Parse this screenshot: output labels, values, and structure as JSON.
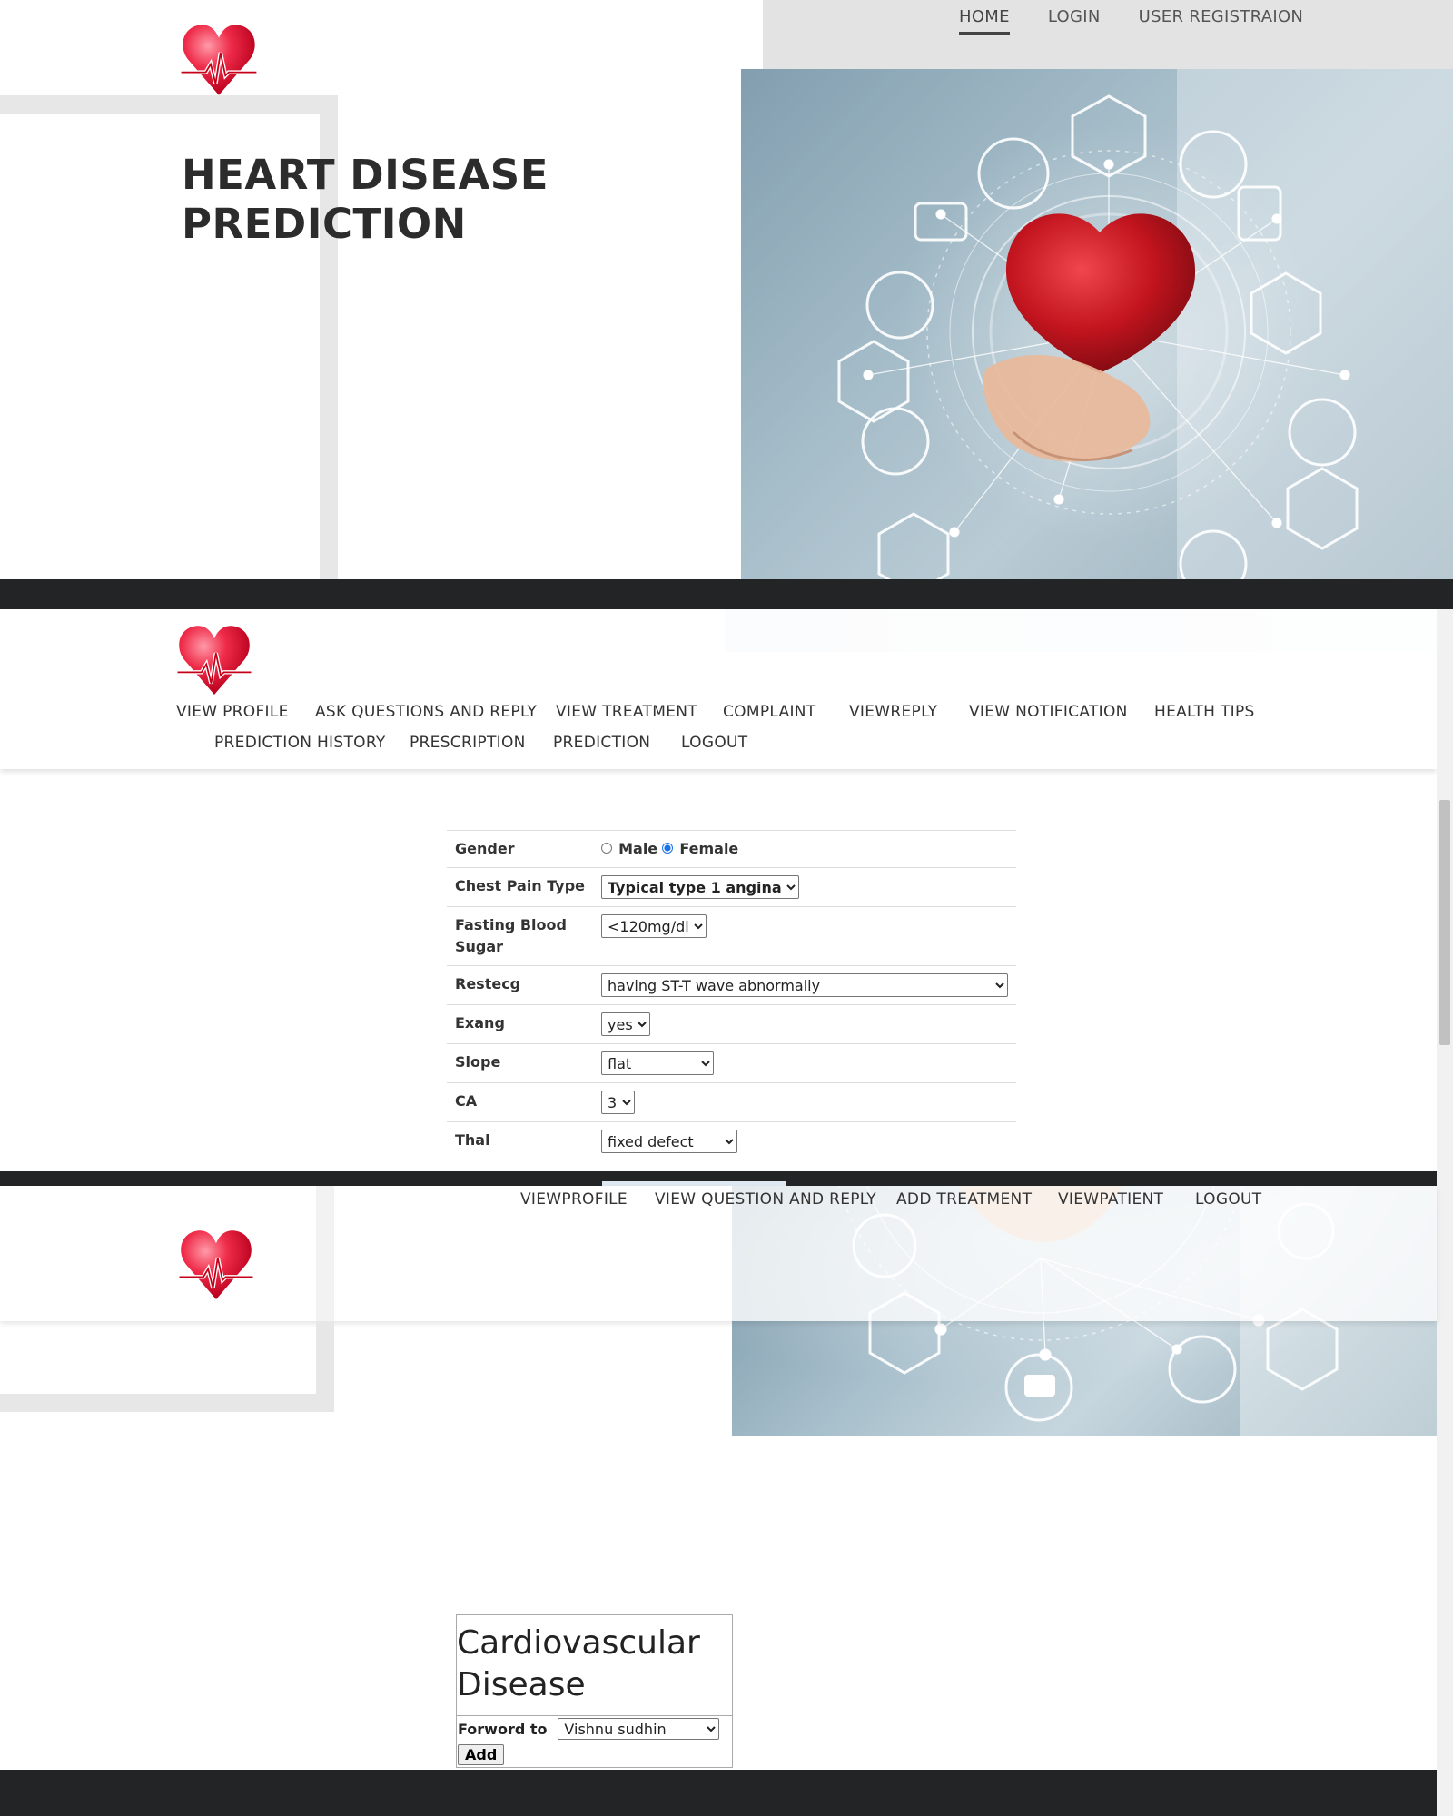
{
  "site": {
    "title_line1": "HEART DISEASE",
    "title_line2": "PREDICTION"
  },
  "top_nav": {
    "home": "HOME",
    "login": "LOGIN",
    "register": "USER REGISTRAION"
  },
  "user_nav": {
    "view_profile": "VIEW PROFILE",
    "ask_questions": "ASK QUESTIONS AND REPLY",
    "view_treatment": "VIEW TREATMENT",
    "complaint": "COMPLAINT",
    "view_reply": "VIEWREPLY",
    "view_notification": "VIEW NOTIFICATION",
    "health_tips": "HEALTH TIPS",
    "prediction_history": "PREDICTION HISTORY",
    "prescription": "PRESCRIPTION",
    "prediction": "PREDICTION",
    "logout": "LOGOUT"
  },
  "prediction_form": {
    "gender_label": "Gender",
    "gender_male": "Male",
    "gender_female": "Female",
    "gender_selected": "Female",
    "chest_pain_label": "Chest Pain Type",
    "chest_pain_value": "Typical type 1 angina",
    "fbs_label": "Fasting Blood Sugar",
    "fbs_value": "<120mg/dl",
    "restecg_label": "Restecg",
    "restecg_value": "having ST-T wave abnormaliy",
    "exang_label": "Exang",
    "exang_value": "yes",
    "slope_label": "Slope",
    "slope_value": "flat",
    "ca_label": "CA",
    "ca_value": "3",
    "thal_label": "Thal",
    "thal_value": "fixed defect"
  },
  "doctor_nav": {
    "view_profile": "VIEWPROFILE",
    "view_question": "VIEW QUESTION AND REPLY",
    "add_treatment": "ADD TREATMENT",
    "view_patient": "VIEWPATIENT",
    "logout": "LOGOUT"
  },
  "forward_card": {
    "title": "Cardiovascular Disease",
    "forward_label": "Forword to",
    "forward_value": "Vishnu sudhin",
    "add_button": "Add"
  },
  "colors": {
    "dark_bar": "#222426",
    "heart_red": "#e0243a",
    "nav_text": "#333333",
    "radio_accent": "#1a73e8"
  },
  "icons": [
    "heart-logo-icon",
    "heart-hand-hero-image",
    "chevron-down-icon"
  ]
}
